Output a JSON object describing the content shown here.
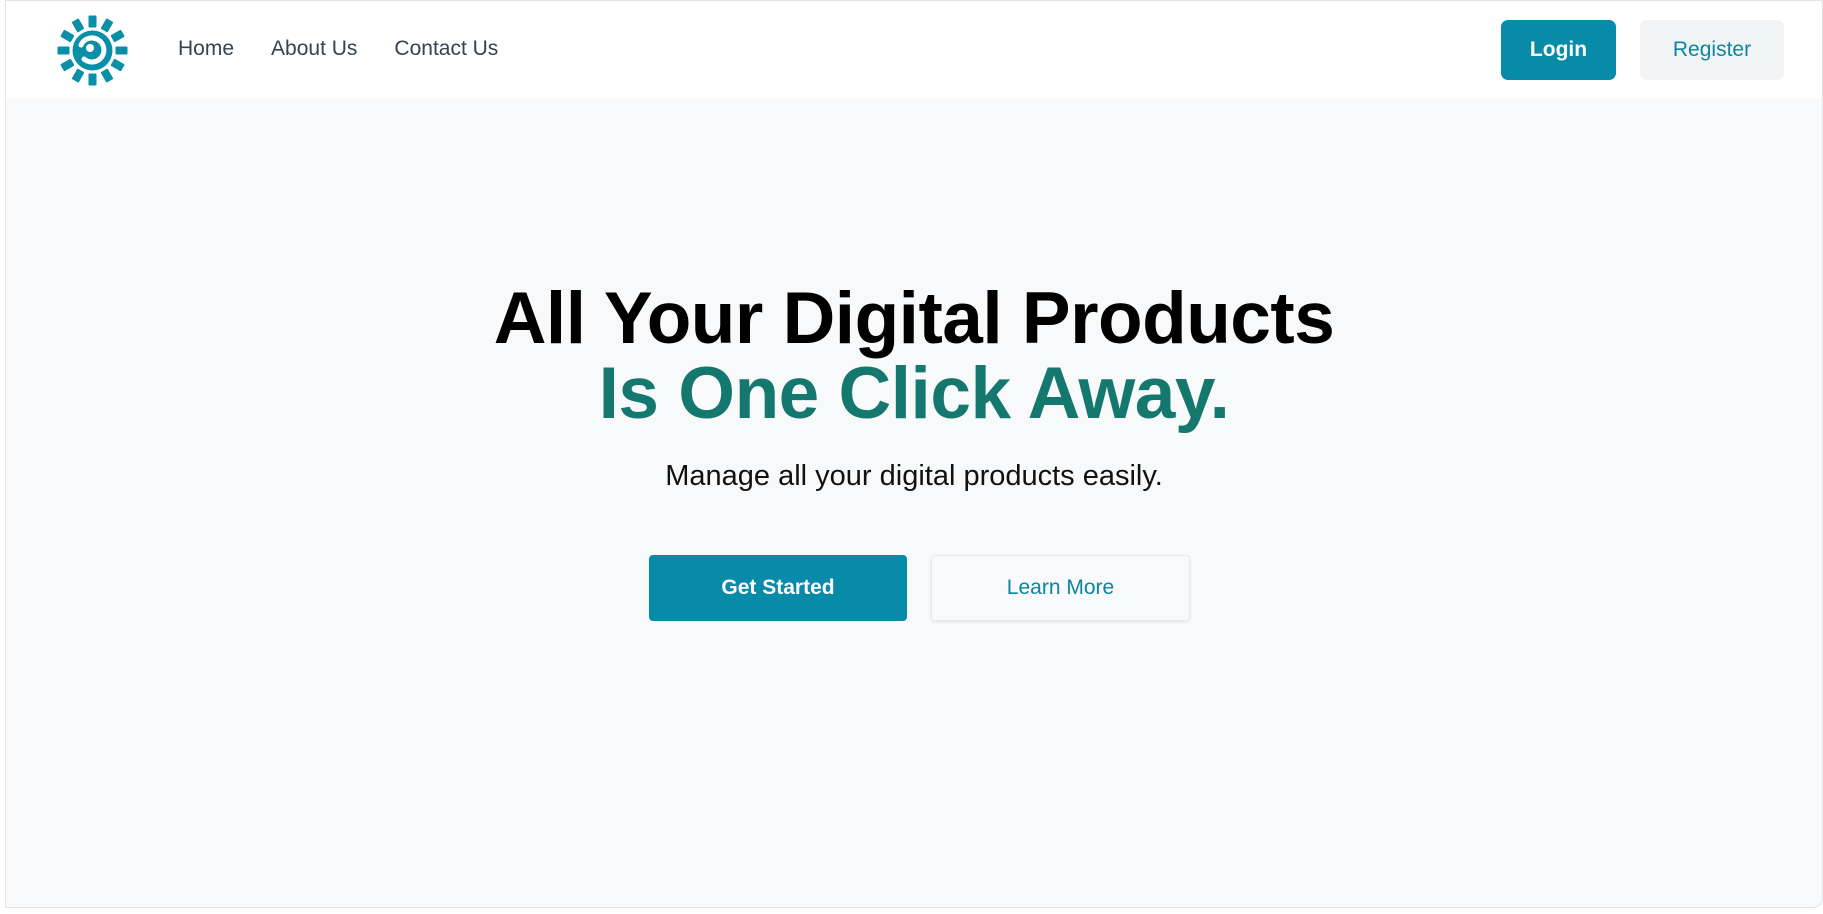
{
  "navbar": {
    "logo_icon": "spinner-ring-logo-icon",
    "links": [
      {
        "label": "Home"
      },
      {
        "label": "About Us"
      },
      {
        "label": "Contact Us"
      }
    ],
    "login_label": "Login",
    "register_label": "Register"
  },
  "hero": {
    "headline_line1": "All Your Digital Products",
    "headline_line2": "Is One Click Away.",
    "subtitle": "Manage all your digital products easily.",
    "primary_cta": "Get Started",
    "secondary_cta": "Learn More"
  },
  "colors": {
    "brand": "#078ba8",
    "accent_text": "#14786e",
    "background": "#f8f9fa"
  }
}
